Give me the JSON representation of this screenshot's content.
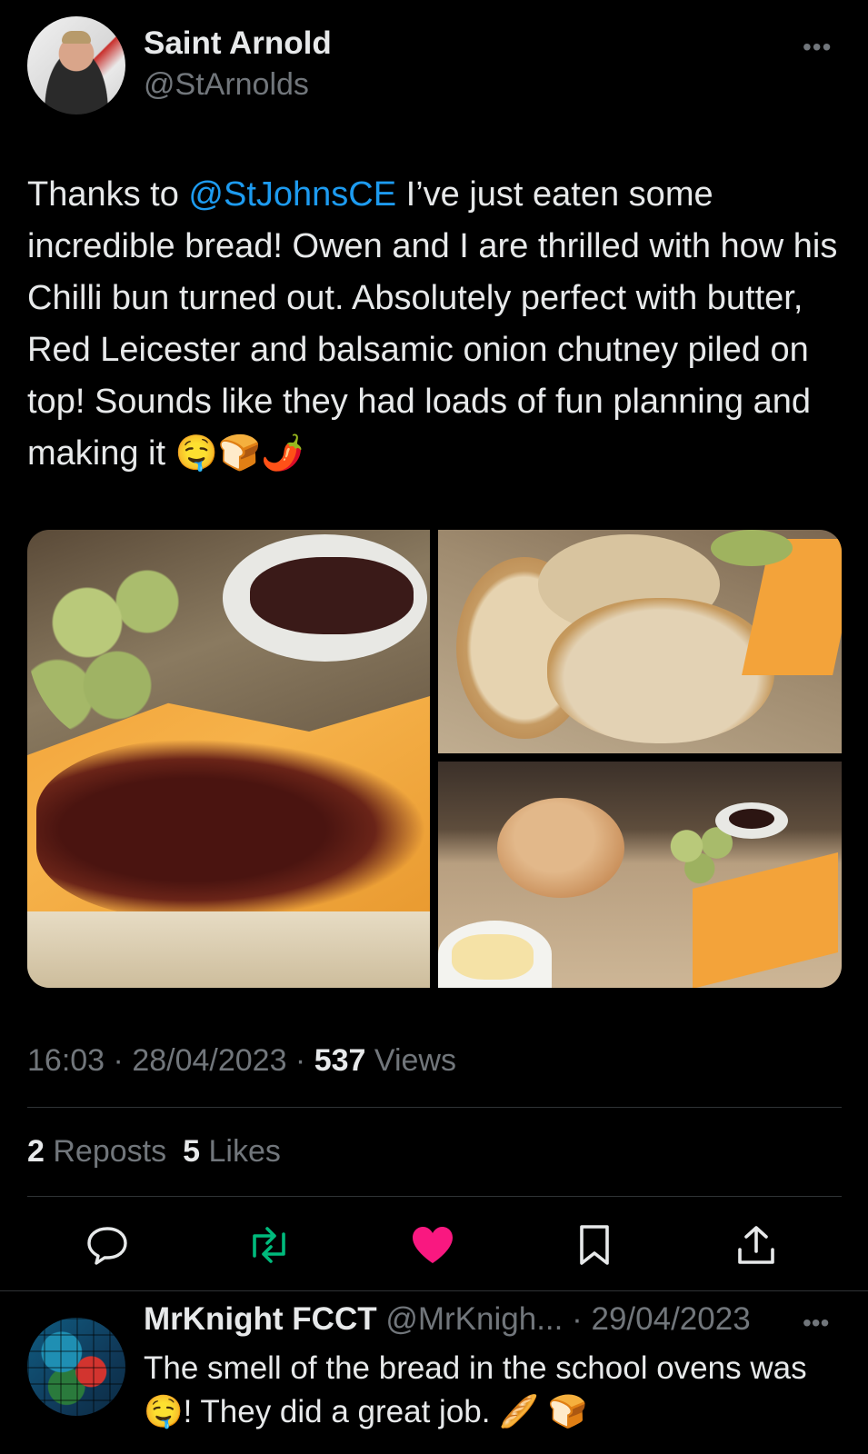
{
  "tweet": {
    "author_name": "Saint Arnold",
    "author_handle": "@StArnolds",
    "more_label": "•••",
    "text_prefix": "Thanks to ",
    "mention": "@StJohnsCE",
    "text_body": " I’ve just eaten some incredible bread! Owen and I are thrilled with how his Chilli bun turned out. Absolutely perfect with butter, Red Leicester and balsamic onion chutney piled on top! Sounds like they had loads of fun planning and making it 🤤🍞🌶️",
    "time": "16:03",
    "date": "28/04/2023",
    "views_count": "537",
    "views_label": "Views",
    "separator": " · ",
    "reposts_count": "2",
    "reposts_label": "Reposts",
    "likes_count": "5",
    "likes_label": "Likes"
  },
  "actions": [
    {
      "name": "reply",
      "icon": "reply-icon"
    },
    {
      "name": "repost",
      "icon": "repost-icon",
      "color": "#00ba7c"
    },
    {
      "name": "like",
      "icon": "heart-icon",
      "color": "#f91880"
    },
    {
      "name": "bookmark",
      "icon": "bookmark-icon"
    },
    {
      "name": "share",
      "icon": "share-icon"
    }
  ],
  "reply": {
    "author_name": "MrKnight FCCT",
    "author_handle": "@MrKnigh...",
    "date": "29/04/2023",
    "separator": " · ",
    "more_label": "•••",
    "text": "The smell of the bread in the school ovens was 🤤! They did a great job. 🥖 🍞"
  },
  "colors": {
    "background": "#000000",
    "text": "#e7e9ea",
    "secondary": "#71767b",
    "link": "#1d9bf0",
    "divider": "#2f3336"
  }
}
